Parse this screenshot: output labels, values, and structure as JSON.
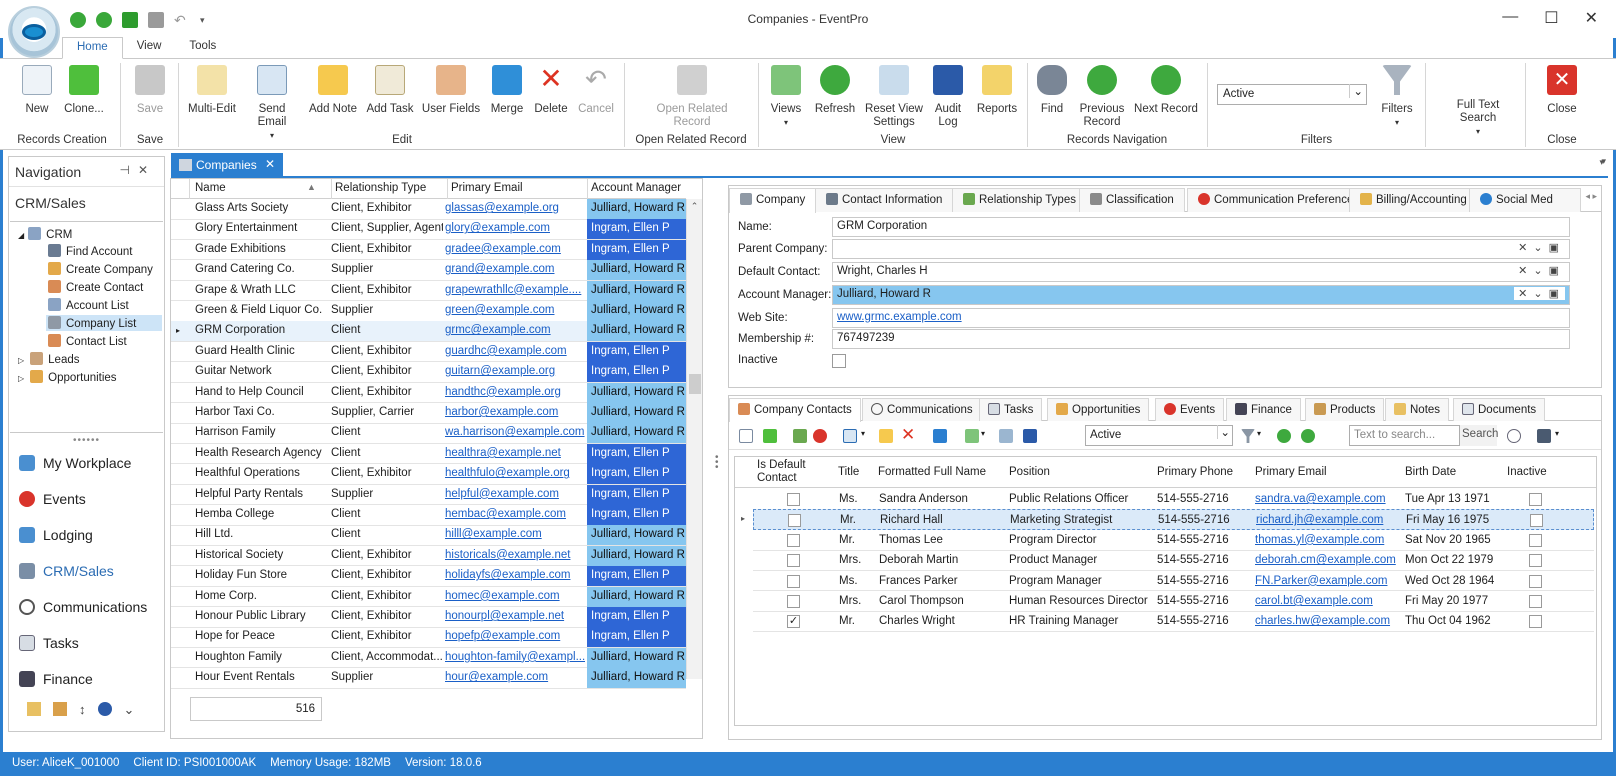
{
  "window": {
    "title": "Companies - EventPro"
  },
  "ribbon_tabs": [
    "Home",
    "View",
    "Tools"
  ],
  "ribbon": {
    "new": "New",
    "clone": "Clone...",
    "save": "Save",
    "multi_edit": "Multi-Edit",
    "send_email": "Send Email",
    "add_note": "Add Note",
    "add_task": "Add Task",
    "user_fields": "User Fields",
    "merge": "Merge",
    "delete": "Delete",
    "cancel": "Cancel",
    "open_related_1": "Open Related",
    "open_related_2": "Record",
    "views": "Views",
    "refresh": "Refresh",
    "reset_view_1": "Reset View",
    "reset_view_2": "Settings",
    "audit_1": "Audit",
    "audit_2": "Log",
    "reports": "Reports",
    "find": "Find",
    "previous_1": "Previous",
    "previous_2": "Record",
    "next_record": "Next Record",
    "filter_value": "Active",
    "filters": "Filters",
    "fulltext_1": "Full Text",
    "fulltext_2": "Search",
    "close": "Close",
    "groups": {
      "records_creation": "Records Creation",
      "save": "Save",
      "edit": "Edit",
      "open_related": "Open Related Record",
      "view": "View",
      "records_navigation": "Records Navigation",
      "filters": "Filters",
      "close": "Close"
    }
  },
  "navigation": {
    "title": "Navigation",
    "category": "CRM/Sales",
    "tree": {
      "crm": "CRM",
      "find_account": "Find Account",
      "create_company": "Create Company",
      "create_contact": "Create Contact",
      "account_list": "Account List",
      "company_list": "Company List",
      "contact_list": "Contact List",
      "leads": "Leads",
      "opportunities": "Opportunities"
    },
    "links": [
      "My Workplace",
      "Events",
      "Lodging",
      "CRM/Sales",
      "Communications",
      "Tasks",
      "Finance"
    ]
  },
  "doc_tab": {
    "label": "Companies"
  },
  "grid": {
    "columns": [
      "Name",
      "Relationship Type",
      "Primary Email",
      "Account Manager"
    ],
    "rows": [
      [
        "Glass Arts Society",
        "Client, Exhibitor",
        "glassas@example.org",
        "Julliard, Howard R"
      ],
      [
        "Glory Entertainment",
        "Client, Supplier, Agent",
        "glory@example.com",
        "Ingram, Ellen P"
      ],
      [
        "Grade Exhibitions",
        "Client, Exhibitor",
        "gradee@example.com",
        "Ingram, Ellen P"
      ],
      [
        "Grand Catering Co.",
        "Supplier",
        "grand@example.com",
        "Julliard, Howard R"
      ],
      [
        "Grape & Wrath LLC",
        "Client, Exhibitor",
        "grapewrathllc@example....",
        "Julliard, Howard R"
      ],
      [
        "Green & Field Liquor Co.",
        "Supplier",
        "green@example.com",
        "Julliard, Howard R"
      ],
      [
        "GRM Corporation",
        "Client",
        "grmc@example.com",
        "Julliard, Howard R"
      ],
      [
        "Guard Health Clinic",
        "Client, Exhibitor",
        "guardhc@example.com",
        "Ingram, Ellen P"
      ],
      [
        "Guitar Network",
        "Client, Exhibitor",
        "guitarn@example.org",
        "Ingram, Ellen P"
      ],
      [
        "Hand to Help Council",
        "Client, Exhibitor",
        "handthc@example.org",
        "Julliard, Howard R"
      ],
      [
        "Harbor Taxi Co.",
        "Supplier, Carrier",
        "harbor@example.com",
        "Julliard, Howard R"
      ],
      [
        "Harrison Family",
        "Client",
        "wa.harrison@example.com",
        "Julliard, Howard R"
      ],
      [
        "Health Research Agency",
        "Client",
        "healthra@example.net",
        "Ingram, Ellen P"
      ],
      [
        "Healthful Operations",
        "Client, Exhibitor",
        "healthfulo@example.org",
        "Ingram, Ellen P"
      ],
      [
        "Helpful Party Rentals",
        "Supplier",
        "helpful@example.com",
        "Ingram, Ellen P"
      ],
      [
        "Hemba College",
        "Client",
        "hembac@example.com",
        "Ingram, Ellen P"
      ],
      [
        "Hill Ltd.",
        "Client",
        "hilll@example.com",
        "Julliard, Howard R"
      ],
      [
        "Historical Society",
        "Client, Exhibitor",
        "historicals@example.net",
        "Julliard, Howard R"
      ],
      [
        "Holiday Fun Store",
        "Client, Exhibitor",
        "holidayfs@example.com",
        "Ingram, Ellen P"
      ],
      [
        "Home Corp.",
        "Client, Exhibitor",
        "homec@example.com",
        "Julliard, Howard R"
      ],
      [
        "Honour Public Library",
        "Client, Exhibitor",
        "honourpl@example.net",
        "Ingram, Ellen P"
      ],
      [
        "Hope for Peace",
        "Client, Exhibitor",
        "hopefp@example.com",
        "Ingram, Ellen P"
      ],
      [
        "Houghton Family",
        "Client, Accommodat...",
        "houghton-family@exampl...",
        "Julliard, Howard R"
      ],
      [
        "Hour Event Rentals",
        "Supplier",
        "hour@example.com",
        "Julliard, Howard R"
      ]
    ],
    "count": "516"
  },
  "detail": {
    "tabs": [
      "Company",
      "Contact Information",
      "Relationship Types",
      "Classification",
      "Communication Preferences",
      "Billing/Accounting",
      "Social Med"
    ],
    "fields": {
      "name_label": "Name:",
      "name": "GRM Corporation",
      "parent_label": "Parent Company:",
      "parent": "",
      "default_contact_label": "Default Contact:",
      "default_contact": "Wright, Charles H",
      "account_manager_label": "Account Manager:",
      "account_manager": "Julliard, Howard R",
      "website_label": "Web Site:",
      "website": "www.grmc.example.com",
      "membership_label": "Membership #:",
      "membership": "767497239",
      "inactive_label": "Inactive"
    }
  },
  "contacts": {
    "tabs": [
      "Company Contacts",
      "Communications",
      "Tasks",
      "Opportunities",
      "Events",
      "Finance",
      "Products",
      "Notes",
      "Documents"
    ],
    "filter_value": "Active",
    "search_placeholder": "Text to search...",
    "search_button": "Search",
    "columns": [
      "Is Default Contact",
      "Title",
      "Formatted Full Name",
      "Position",
      "Primary Phone",
      "Primary Email",
      "Birth Date",
      "Inactive"
    ],
    "rows": [
      {
        "default": false,
        "title": "Ms.",
        "name": "Sandra Anderson",
        "position": "Public Relations Officer",
        "phone": "514-555-2716",
        "email": "sandra.va@example.com",
        "birth": "Tue Apr 13 1971"
      },
      {
        "default": false,
        "title": "Mr.",
        "name": "Richard Hall",
        "position": "Marketing Strategist",
        "phone": "514-555-2716",
        "email": "richard.jh@example.com",
        "birth": "Fri May 16 1975"
      },
      {
        "default": false,
        "title": "Mr.",
        "name": "Thomas Lee",
        "position": "Program Director",
        "phone": "514-555-2716",
        "email": "thomas.yl@example.com",
        "birth": "Sat Nov 20 1965"
      },
      {
        "default": false,
        "title": "Mrs.",
        "name": "Deborah Martin",
        "position": "Product Manager",
        "phone": "514-555-2716",
        "email": "deborah.cm@example.com",
        "birth": "Mon Oct 22 1979"
      },
      {
        "default": false,
        "title": "Ms.",
        "name": "Frances Parker",
        "position": "Program Manager",
        "phone": "514-555-2716",
        "email": "FN.Parker@example.com",
        "birth": "Wed Oct 28 1964"
      },
      {
        "default": false,
        "title": "Mrs.",
        "name": "Carol Thompson",
        "position": "Human Resources Director",
        "phone": "514-555-2716",
        "email": "carol.bt@example.com",
        "birth": "Fri May 20 1977"
      },
      {
        "default": true,
        "title": "Mr.",
        "name": "Charles Wright",
        "position": "HR Training Manager",
        "phone": "514-555-2716",
        "email": "charles.hw@example.com",
        "birth": "Thu Oct 04 1962"
      }
    ]
  },
  "status": {
    "user": "User: AliceK_001000",
    "client": "Client ID: PSI001000AK",
    "memory": "Memory Usage: 182MB",
    "version": "Version: 18.0.6"
  },
  "colors": {
    "accent": "#2b7fd0",
    "ingram": "#2e66d6",
    "julliard": "#86c6ef",
    "link": "#1a5fc7"
  }
}
